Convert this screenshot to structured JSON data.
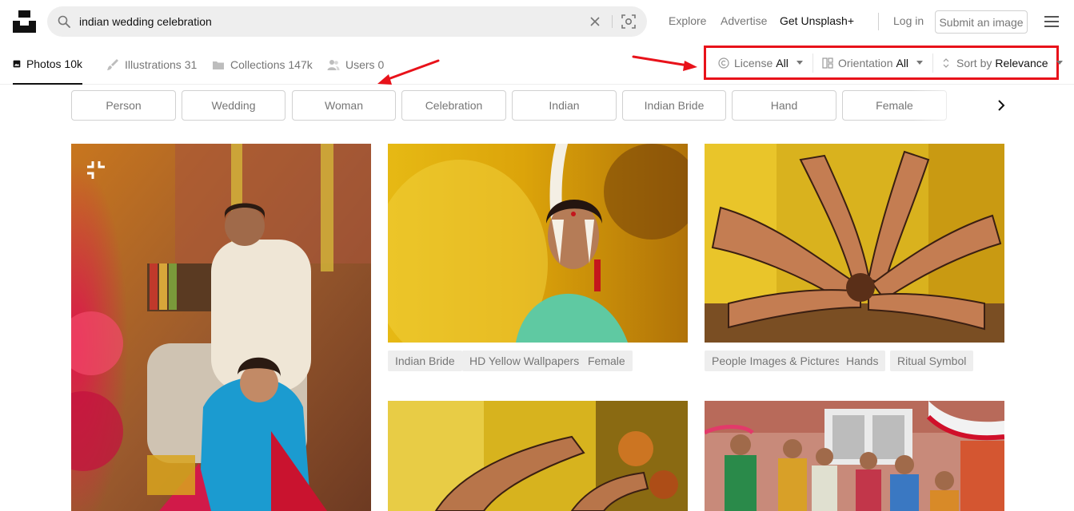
{
  "search": {
    "query": "indian wedding celebration"
  },
  "nav": {
    "explore": "Explore",
    "advertise": "Advertise",
    "get_plus": "Get Unsplash+",
    "login": "Log in",
    "submit": "Submit an image"
  },
  "tabs": [
    {
      "label": "Photos 10k",
      "icon": "photo-icon",
      "active": true
    },
    {
      "label": "Illustrations 31",
      "icon": "brush-icon"
    },
    {
      "label": "Collections 147k",
      "icon": "collection-icon"
    },
    {
      "label": "Users 0",
      "icon": "users-icon"
    }
  ],
  "filters": {
    "license": {
      "label": "License",
      "value": "All",
      "icon": "copyright-icon"
    },
    "orientation": {
      "label": "Orientation",
      "value": "All",
      "icon": "orientation-icon"
    },
    "sort": {
      "label": "Sort by",
      "value": "Relevance",
      "icon": "sort-icon"
    }
  },
  "chips": [
    "Person",
    "Wedding",
    "Woman",
    "Celebration",
    "Indian",
    "Indian Bride",
    "Hand",
    "Female"
  ],
  "photo_tags": {
    "photo2": [
      "Indian Bride",
      "HD Yellow Wallpapers",
      "Female"
    ],
    "photo3": [
      "People Images & Pictures",
      "Hands",
      "Ritual Symbol"
    ]
  },
  "colors": {
    "annotation": "#e8121a",
    "chip_border": "#d1d1d1",
    "muted_text": "#767676"
  }
}
